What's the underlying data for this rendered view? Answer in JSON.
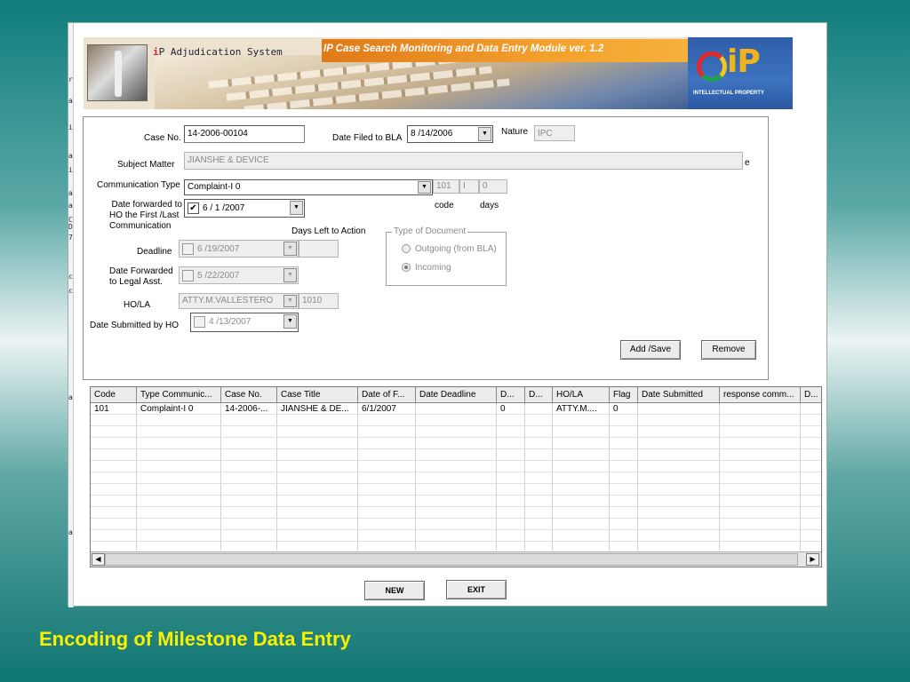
{
  "banner": {
    "title_prefix": "i",
    "title_rest": "P Adjudication System",
    "module_title": "IP Case Search Monitoring and Data Entry Module ver. 1.2",
    "logo_text": "iP",
    "logo_caption": "INTELLECTUAL PROPERTY"
  },
  "form": {
    "case_no_label": "Case No.",
    "case_no": "14-2006-00104",
    "date_filed_label": "Date Filed to BLA",
    "date_filed": "8 /14/2006",
    "nature_label": "Nature",
    "nature": "IPC",
    "subject_matter_label": "Subject Matter",
    "subject_matter": "JIANSHE & DEVICE",
    "subject_trailing": "e",
    "comm_type_label": "Communication Type",
    "comm_type": "Complaint-I 0",
    "comm_code_value": "101",
    "comm_flag_value": "I",
    "comm_days_value": "0",
    "code_label": "code",
    "days_label": "days",
    "date_forwarded_label_1": "Date forwarded to",
    "date_forwarded_label_2": "HO the First /Last",
    "date_forwarded_label_3": "Communication",
    "date_forwarded": "6 / 1 /2007",
    "days_left_label": "Days Left to Action",
    "deadline_label": "Deadline",
    "deadline": "6 /19/2007",
    "fwd_legal_label_1": "Date Forwarded",
    "fwd_legal_label_2": "to Legal Asst.",
    "fwd_legal": "5 /22/2007",
    "hola_label": "HO/LA",
    "hola": "ATTY.M.VALLESTERO",
    "hola_code": "1010",
    "submitted_label": "Date Submitted  by HO",
    "submitted": "4 /13/2007",
    "doc_type_title": "Type of Document",
    "doc_outgoing": "Outgoing (from BLA)",
    "doc_incoming": "Incoming",
    "add_save": "Add /Save",
    "remove": "Remove"
  },
  "grid": {
    "columns": [
      "Code",
      "Type Communic...",
      "Case No.",
      "Case Title",
      "Date of F...",
      "Date Deadline",
      "D...",
      "D...",
      "HO/LA",
      "Flag",
      "Date Submitted",
      "response comm...",
      "D..."
    ],
    "rows": [
      [
        "101",
        "Complaint-I 0",
        "14-2006-...",
        "JIANSHE & DE...",
        "6/1/2007",
        "",
        "0",
        "",
        "ATTY.M....",
        "0",
        "",
        "",
        ""
      ]
    ]
  },
  "footer": {
    "new": "NEW",
    "exit": "EXIT"
  },
  "caption": "Encoding of Milestone Data Entry",
  "left_strip": [
    "r",
    "a",
    "i",
    "a",
    "i",
    "a",
    "a",
    "C",
    "D",
    "7",
    "c",
    "c",
    "a",
    "a"
  ]
}
